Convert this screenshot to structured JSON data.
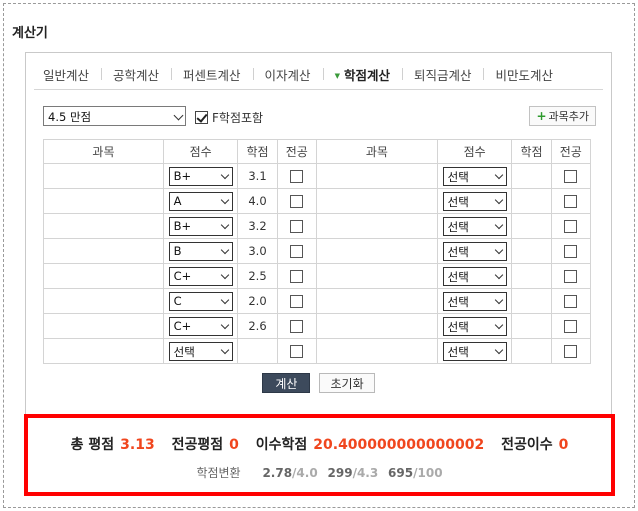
{
  "title": "계산기",
  "tabs": [
    {
      "label": "일반계산",
      "active": false
    },
    {
      "label": "공학계산",
      "active": false
    },
    {
      "label": "퍼센트계산",
      "active": false
    },
    {
      "label": "이자계산",
      "active": false
    },
    {
      "label": "학점계산",
      "active": true
    },
    {
      "label": "퇴직금계산",
      "active": false
    },
    {
      "label": "비만도계산",
      "active": false
    }
  ],
  "controls": {
    "scale_select": "4.5 만점",
    "f_include_label": "F학점포함",
    "f_include_checked": true,
    "add_course_label": "과목추가"
  },
  "table": {
    "headers": [
      "과목",
      "점수",
      "학점",
      "전공",
      "과목",
      "점수",
      "학점",
      "전공"
    ],
    "rows": [
      {
        "left": {
          "grade": "B+",
          "credit": "3.1"
        },
        "right": {
          "grade": "선택",
          "credit": ""
        }
      },
      {
        "left": {
          "grade": "A",
          "credit": "4.0"
        },
        "right": {
          "grade": "선택",
          "credit": ""
        }
      },
      {
        "left": {
          "grade": "B+",
          "credit": "3.2"
        },
        "right": {
          "grade": "선택",
          "credit": ""
        }
      },
      {
        "left": {
          "grade": "B",
          "credit": "3.0"
        },
        "right": {
          "grade": "선택",
          "credit": ""
        }
      },
      {
        "left": {
          "grade": "C+",
          "credit": "2.5"
        },
        "right": {
          "grade": "선택",
          "credit": ""
        }
      },
      {
        "left": {
          "grade": "C",
          "credit": "2.0"
        },
        "right": {
          "grade": "선택",
          "credit": ""
        }
      },
      {
        "left": {
          "grade": "C+",
          "credit": "2.6"
        },
        "right": {
          "grade": "선택",
          "credit": ""
        }
      },
      {
        "left": {
          "grade": "선택",
          "credit": ""
        },
        "right": {
          "grade": "선택",
          "credit": ""
        }
      }
    ]
  },
  "buttons": {
    "calculate": "계산",
    "reset": "초기화"
  },
  "result": {
    "total_gpa_label": "총 평점",
    "total_gpa": "3.13",
    "major_gpa_label": "전공평점",
    "major_gpa": "0",
    "credits_label": "이수학점",
    "credits": "20.400000000000002",
    "major_credits_label": "전공이수",
    "major_credits": "0",
    "conversion_label": "학점변환",
    "conversions": [
      {
        "value": "2.78",
        "max": "/4.0"
      },
      {
        "value": "299",
        "max": "/4.3"
      },
      {
        "value": "695",
        "max": "/100"
      }
    ]
  },
  "colors": {
    "accent": "#f0461e",
    "highlight_border": "#ff0000",
    "primary_button": "#3d4a5c"
  }
}
